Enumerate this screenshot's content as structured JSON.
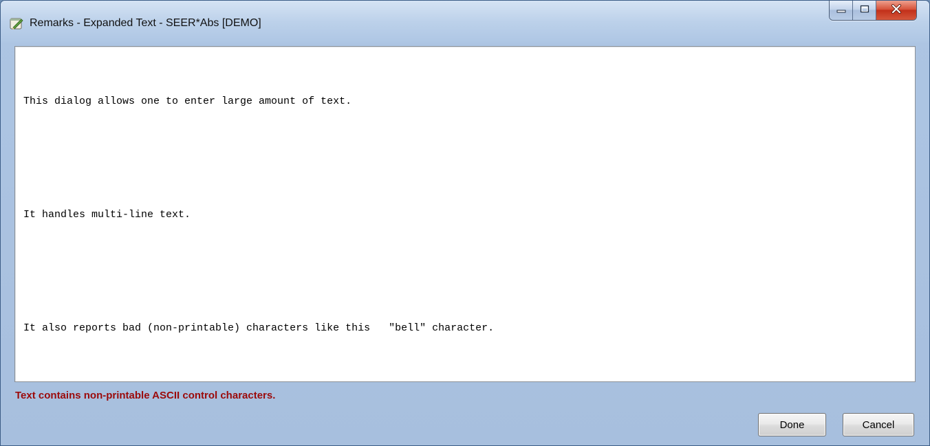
{
  "window": {
    "title": "Remarks - Expanded Text - SEER*Abs [DEMO]",
    "app_icon": "pencil-notebook-icon",
    "controls": {
      "minimize": "minimize-icon",
      "maximize": "maximize-icon",
      "close": "close-icon"
    }
  },
  "editor": {
    "lines": [
      "This dialog allows one to enter large amount of text.",
      "",
      "It handles multi-line text.",
      "",
      "It also reports bad (non-printable) characters like this   \"bell\" character."
    ]
  },
  "status": {
    "message": "Text contains non-printable ASCII control characters.",
    "color": "#9b0a0a"
  },
  "buttons": {
    "done_label": "Done",
    "cancel_label": "Cancel"
  }
}
